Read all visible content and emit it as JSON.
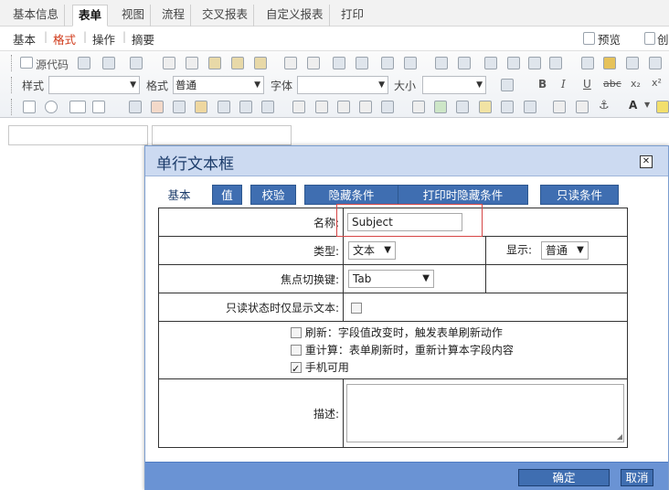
{
  "top_tabs": [
    "基本信息",
    "表单",
    "视图",
    "流程",
    "交叉报表",
    "自定义报表",
    "打印"
  ],
  "sub_tabs": [
    "基本",
    "格式",
    "操作",
    "摘要"
  ],
  "right_buttons": {
    "preview": "预览",
    "create": "创"
  },
  "toolbar": {
    "row1": [
      "源代码"
    ],
    "row2": {
      "style_label": "样式",
      "format_label": "格式",
      "format_value": "普通",
      "font_label": "字体",
      "size_label": "大小"
    }
  },
  "dialog": {
    "title": "单行文本框",
    "tabs": [
      "基本",
      "值",
      "校验",
      "隐藏条件",
      "打印时隐藏条件",
      "只读条件"
    ],
    "name_label": "名称:",
    "name_value": "Subject",
    "type_label": "类型:",
    "type_value": "文本",
    "display_label": "显示:",
    "display_value": "普通",
    "focus_label": "焦点切换键:",
    "focus_value": "Tab",
    "readonly_label": "只读状态时仅显示文本:",
    "options": [
      {
        "text": "刷新：字段值改变时，触发表单刷新动作",
        "checked": false
      },
      {
        "text": "重计算：表单刷新时，重新计算本字段内容",
        "checked": false
      },
      {
        "text": "手机可用",
        "checked": true
      }
    ],
    "desc_label": "描述:",
    "ok": "确定",
    "cancel": "取消"
  }
}
